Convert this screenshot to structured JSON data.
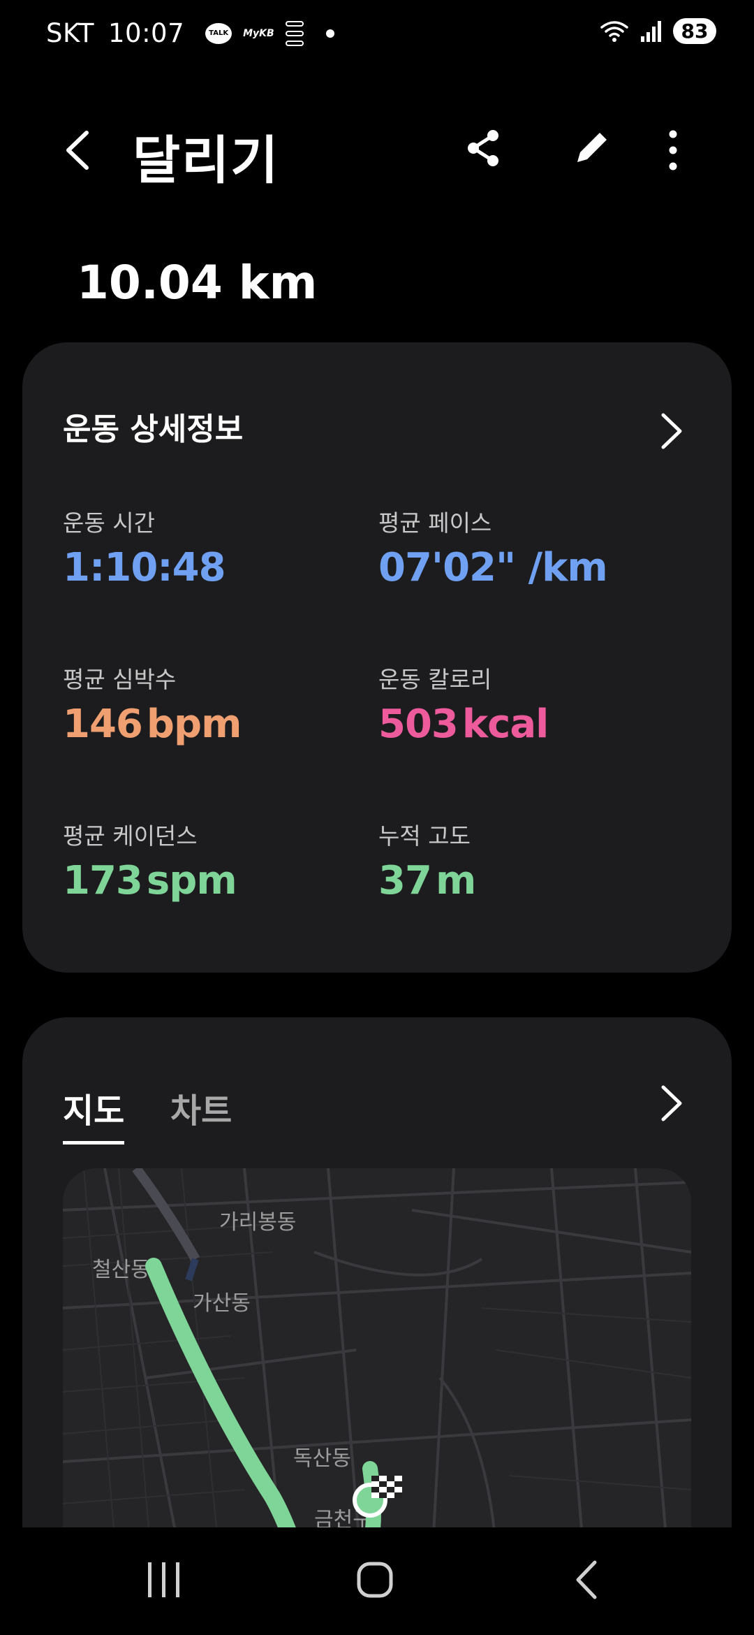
{
  "status_bar": {
    "carrier": "SKT",
    "time": "10:07",
    "talk_badge": "TALK",
    "kb_badge": "MyKB",
    "battery": "83"
  },
  "header": {
    "title": "달리기",
    "icons": [
      "back-icon",
      "share-icon",
      "edit-icon",
      "more-icon"
    ]
  },
  "summary": {
    "distance": "10.04 km"
  },
  "details_card": {
    "title": "운동 상세정보",
    "stats": [
      {
        "label": "운동 시간",
        "value": "1:10:48",
        "unit": "",
        "color": "#6fa0f2"
      },
      {
        "label": "평균 페이스",
        "value": "07'02\" /km",
        "unit": "",
        "color": "#6fa0f2"
      },
      {
        "label": "평균 심박수",
        "value": "146",
        "unit": "bpm",
        "color": "#f0a070"
      },
      {
        "label": "운동 칼로리",
        "value": "503",
        "unit": "kcal",
        "color": "#ed5b9c"
      },
      {
        "label": "평균 케이던스",
        "value": "173",
        "unit": "spm",
        "color": "#7ed597"
      },
      {
        "label": "누적 고도",
        "value": "37",
        "unit": "m",
        "color": "#7ed597"
      }
    ]
  },
  "map_card": {
    "tabs": [
      {
        "label": "지도",
        "active": true
      },
      {
        "label": "차트",
        "active": false
      }
    ],
    "map_labels": [
      "가리봉동",
      "철산동",
      "가산동",
      "독산동",
      "금천구"
    ],
    "route_color": "#7ed597"
  }
}
